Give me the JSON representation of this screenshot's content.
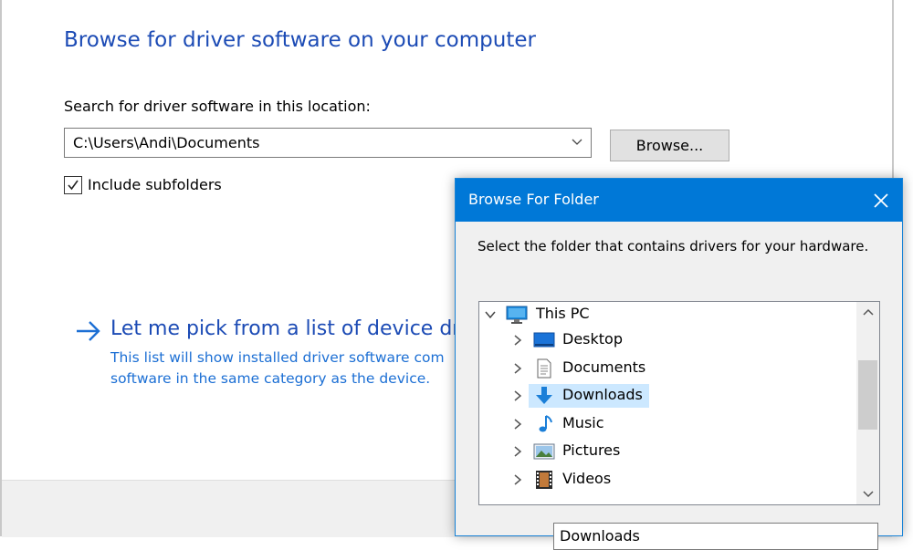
{
  "wizard": {
    "title": "Browse for driver software on your computer",
    "search_label": "Search for driver software in this location:",
    "path_value": "C:\\Users\\Andi\\Documents",
    "browse_button": "Browse...",
    "include_subfolders": {
      "label": "Include subfolders",
      "checked": true
    },
    "pick_title": "Let me pick from a list of device driv",
    "pick_desc_line1": "This list will show installed driver software com",
    "pick_desc_line2": "software in the same category as the device."
  },
  "dialog": {
    "title": "Browse For Folder",
    "instruction": "Select the folder that contains drivers for your hardware.",
    "tree": {
      "root": {
        "label": "This PC",
        "icon": "monitor-icon",
        "expanded": true
      },
      "items": [
        {
          "label": "Desktop",
          "icon": "desktop-icon"
        },
        {
          "label": "Documents",
          "icon": "document-icon"
        },
        {
          "label": "Downloads",
          "icon": "download-icon",
          "selected": true
        },
        {
          "label": "Music",
          "icon": "music-note-icon"
        },
        {
          "label": "Pictures",
          "icon": "picture-icon"
        },
        {
          "label": "Videos",
          "icon": "film-icon"
        }
      ]
    },
    "folder_value": "Downloads"
  },
  "colors": {
    "accent": "#0078d7",
    "link_blue": "#1c4bb5",
    "selection": "#cce8ff"
  }
}
